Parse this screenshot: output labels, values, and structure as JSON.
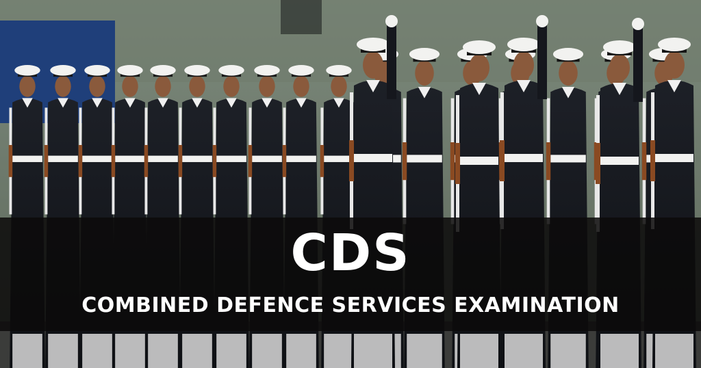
{
  "banner": {
    "title": "CDS",
    "subtitle": "COMBINED DEFENCE SERVICES EXAMINATION"
  },
  "colors": {
    "uniform": "#14161c",
    "cap_white": "#f2f2f0",
    "banner_bg": "#0c0a0a",
    "sign_blue": "#1f3f7a",
    "sky": "#8c9a8a"
  },
  "photo": {
    "subject": "marching-cadets"
  }
}
